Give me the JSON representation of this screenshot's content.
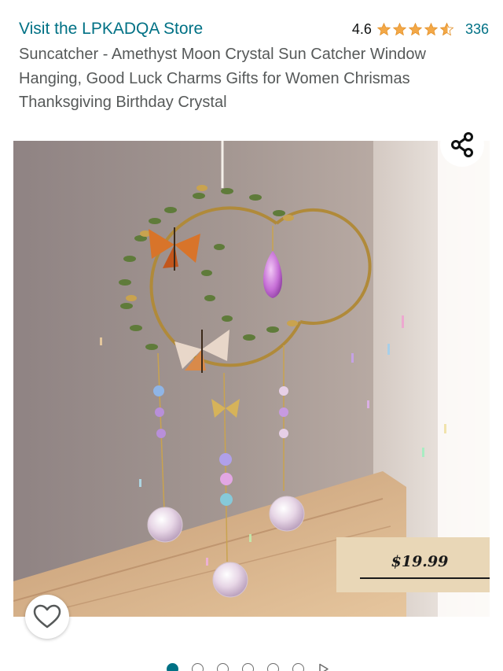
{
  "header": {
    "store_link": "Visit the LPKADQA Store",
    "rating_value": "4.6",
    "star_rating": 4.6,
    "review_count": "336",
    "star_color": "#f3a847"
  },
  "product": {
    "title": "Suncatcher - Amethyst Moon Crystal Sun Catcher Window Hanging, Good Luck Charms Gifts for Women Chrismas Thanksgiving Birthday Crystal"
  },
  "image": {
    "price_tag_text": "$19.99",
    "share_icon": "share-icon",
    "wishlist_icon": "heart-icon"
  },
  "carousel": {
    "dot_count": 6,
    "active_index": 0,
    "has_video": true
  },
  "colors": {
    "link": "#007185",
    "title": "#565959"
  }
}
